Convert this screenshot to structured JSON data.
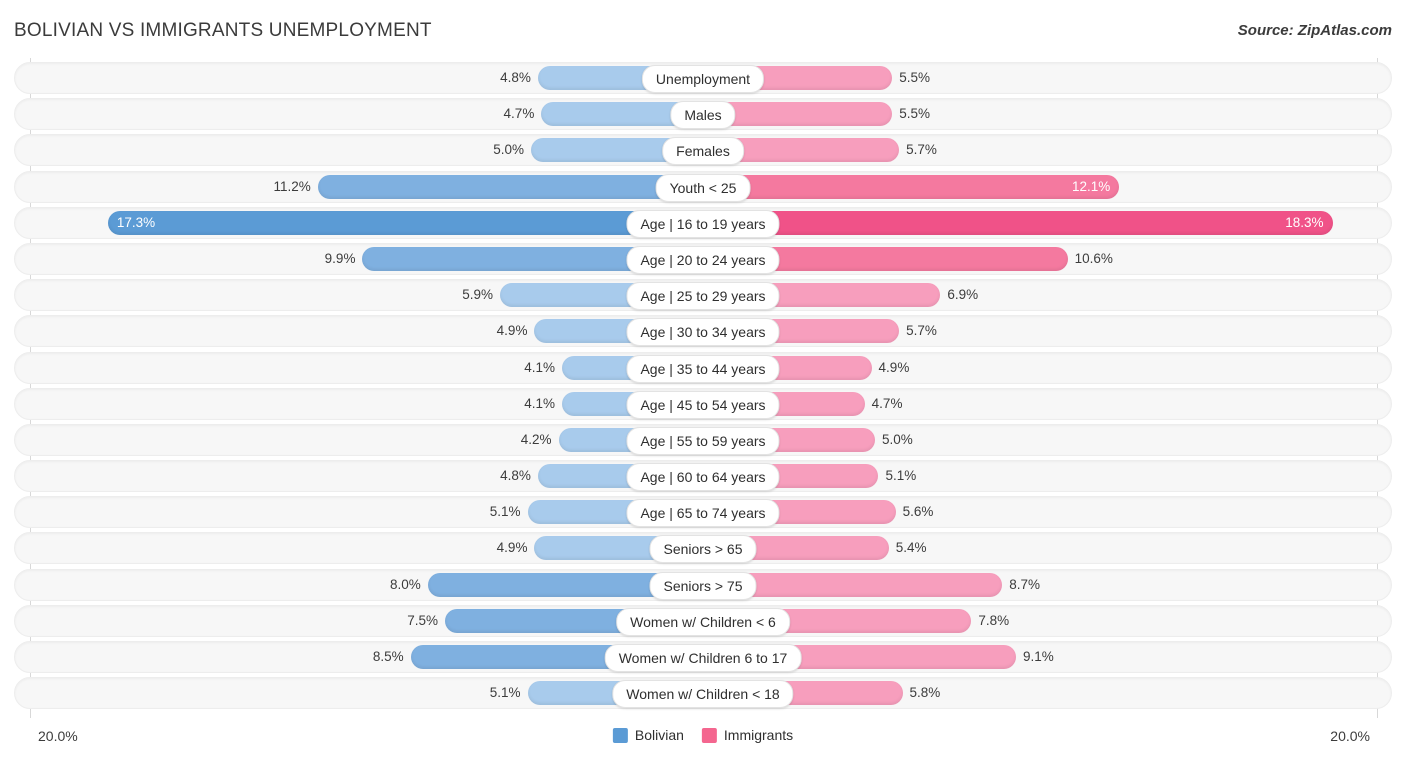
{
  "header": {
    "title": "BOLIVIAN VS IMMIGRANTS UNEMPLOYMENT",
    "source": "Source: ZipAtlas.com"
  },
  "footer": {
    "left_axis_label": "20.0%",
    "right_axis_label": "20.0%",
    "legend": [
      {
        "label": "Bolivian",
        "color": "#5B9BD5"
      },
      {
        "label": "Immigrants",
        "color": "#F4668F"
      }
    ]
  },
  "colors": {
    "blue_light": "#A8CBEC",
    "blue_mid": "#7FB0E0",
    "blue_strong": "#5B9BD5",
    "pink_light": "#F79EBD",
    "pink_mid": "#F4799F",
    "pink_strong": "#F05288",
    "track": "#f7f7f7",
    "text": "#3c3c3c"
  },
  "chart_data": {
    "type": "bar",
    "title": "BOLIVIAN VS IMMIGRANTS UNEMPLOYMENT",
    "subtitle": "",
    "xlabel": "",
    "ylabel": "",
    "orientation": "horizontal-diverging",
    "axis_max": 20.0,
    "axis_unit": "%",
    "xlim": [
      20.0,
      20.0
    ],
    "grid": false,
    "legend_position": "bottom-center",
    "categories": [
      "Unemployment",
      "Males",
      "Females",
      "Youth < 25",
      "Age | 16 to 19 years",
      "Age | 20 to 24 years",
      "Age | 25 to 29 years",
      "Age | 30 to 34 years",
      "Age | 35 to 44 years",
      "Age | 45 to 54 years",
      "Age | 55 to 59 years",
      "Age | 60 to 64 years",
      "Age | 65 to 74 years",
      "Seniors > 65",
      "Seniors > 75",
      "Women w/ Children < 6",
      "Women w/ Children 6 to 17",
      "Women w/ Children < 18"
    ],
    "series": [
      {
        "name": "Bolivian",
        "color": "#5B9BD5",
        "values": [
          4.8,
          4.7,
          5.0,
          11.2,
          17.3,
          9.9,
          5.9,
          4.9,
          4.1,
          4.1,
          4.2,
          4.8,
          5.1,
          4.9,
          8.0,
          7.5,
          8.5,
          5.1
        ]
      },
      {
        "name": "Immigrants",
        "color": "#F4668F",
        "values": [
          5.5,
          5.5,
          5.7,
          12.1,
          18.3,
          10.6,
          6.9,
          5.7,
          4.9,
          4.7,
          5.0,
          5.1,
          5.6,
          5.4,
          8.7,
          7.8,
          9.1,
          5.8
        ]
      }
    ]
  },
  "rows": [
    {
      "label": "Unemployment",
      "left": "4.8%",
      "right": "5.5%",
      "lv": 4.8,
      "rv": 5.5,
      "lshade": "light",
      "rshade": "light",
      "linside": false,
      "rinside": false
    },
    {
      "label": "Males",
      "left": "4.7%",
      "right": "5.5%",
      "lv": 4.7,
      "rv": 5.5,
      "lshade": "light",
      "rshade": "light",
      "linside": false,
      "rinside": false
    },
    {
      "label": "Females",
      "left": "5.0%",
      "right": "5.7%",
      "lv": 5.0,
      "rv": 5.7,
      "lshade": "light",
      "rshade": "light",
      "linside": false,
      "rinside": false
    },
    {
      "label": "Youth < 25",
      "left": "11.2%",
      "right": "12.1%",
      "lv": 11.2,
      "rv": 12.1,
      "lshade": "mid",
      "rshade": "mid",
      "linside": false,
      "rinside": true
    },
    {
      "label": "Age | 16 to 19 years",
      "left": "17.3%",
      "right": "18.3%",
      "lv": 17.3,
      "rv": 18.3,
      "lshade": "strong",
      "rshade": "strong",
      "linside": true,
      "rinside": true
    },
    {
      "label": "Age | 20 to 24 years",
      "left": "9.9%",
      "right": "10.6%",
      "lv": 9.9,
      "rv": 10.6,
      "lshade": "mid",
      "rshade": "mid",
      "linside": false,
      "rinside": false
    },
    {
      "label": "Age | 25 to 29 years",
      "left": "5.9%",
      "right": "6.9%",
      "lv": 5.9,
      "rv": 6.9,
      "lshade": "light",
      "rshade": "light",
      "linside": false,
      "rinside": false
    },
    {
      "label": "Age | 30 to 34 years",
      "left": "4.9%",
      "right": "5.7%",
      "lv": 4.9,
      "rv": 5.7,
      "lshade": "light",
      "rshade": "light",
      "linside": false,
      "rinside": false
    },
    {
      "label": "Age | 35 to 44 years",
      "left": "4.1%",
      "right": "4.9%",
      "lv": 4.1,
      "rv": 4.9,
      "lshade": "light",
      "rshade": "light",
      "linside": false,
      "rinside": false
    },
    {
      "label": "Age | 45 to 54 years",
      "left": "4.1%",
      "right": "4.7%",
      "lv": 4.1,
      "rv": 4.7,
      "lshade": "light",
      "rshade": "light",
      "linside": false,
      "rinside": false
    },
    {
      "label": "Age | 55 to 59 years",
      "left": "4.2%",
      "right": "5.0%",
      "lv": 4.2,
      "rv": 5.0,
      "lshade": "light",
      "rshade": "light",
      "linside": false,
      "rinside": false
    },
    {
      "label": "Age | 60 to 64 years",
      "left": "4.8%",
      "right": "5.1%",
      "lv": 4.8,
      "rv": 5.1,
      "lshade": "light",
      "rshade": "light",
      "linside": false,
      "rinside": false
    },
    {
      "label": "Age | 65 to 74 years",
      "left": "5.1%",
      "right": "5.6%",
      "lv": 5.1,
      "rv": 5.6,
      "lshade": "light",
      "rshade": "light",
      "linside": false,
      "rinside": false
    },
    {
      "label": "Seniors > 65",
      "left": "4.9%",
      "right": "5.4%",
      "lv": 4.9,
      "rv": 5.4,
      "lshade": "light",
      "rshade": "light",
      "linside": false,
      "rinside": false
    },
    {
      "label": "Seniors > 75",
      "left": "8.0%",
      "right": "8.7%",
      "lv": 8.0,
      "rv": 8.7,
      "lshade": "mid",
      "rshade": "light",
      "linside": false,
      "rinside": false
    },
    {
      "label": "Women w/ Children < 6",
      "left": "7.5%",
      "right": "7.8%",
      "lv": 7.5,
      "rv": 7.8,
      "lshade": "mid",
      "rshade": "light",
      "linside": false,
      "rinside": false
    },
    {
      "label": "Women w/ Children 6 to 17",
      "left": "8.5%",
      "right": "9.1%",
      "lv": 8.5,
      "rv": 9.1,
      "lshade": "mid",
      "rshade": "light",
      "linside": false,
      "rinside": false
    },
    {
      "label": "Women w/ Children < 18",
      "left": "5.1%",
      "right": "5.8%",
      "lv": 5.1,
      "rv": 5.8,
      "lshade": "light",
      "rshade": "light",
      "linside": false,
      "rinside": false
    }
  ]
}
